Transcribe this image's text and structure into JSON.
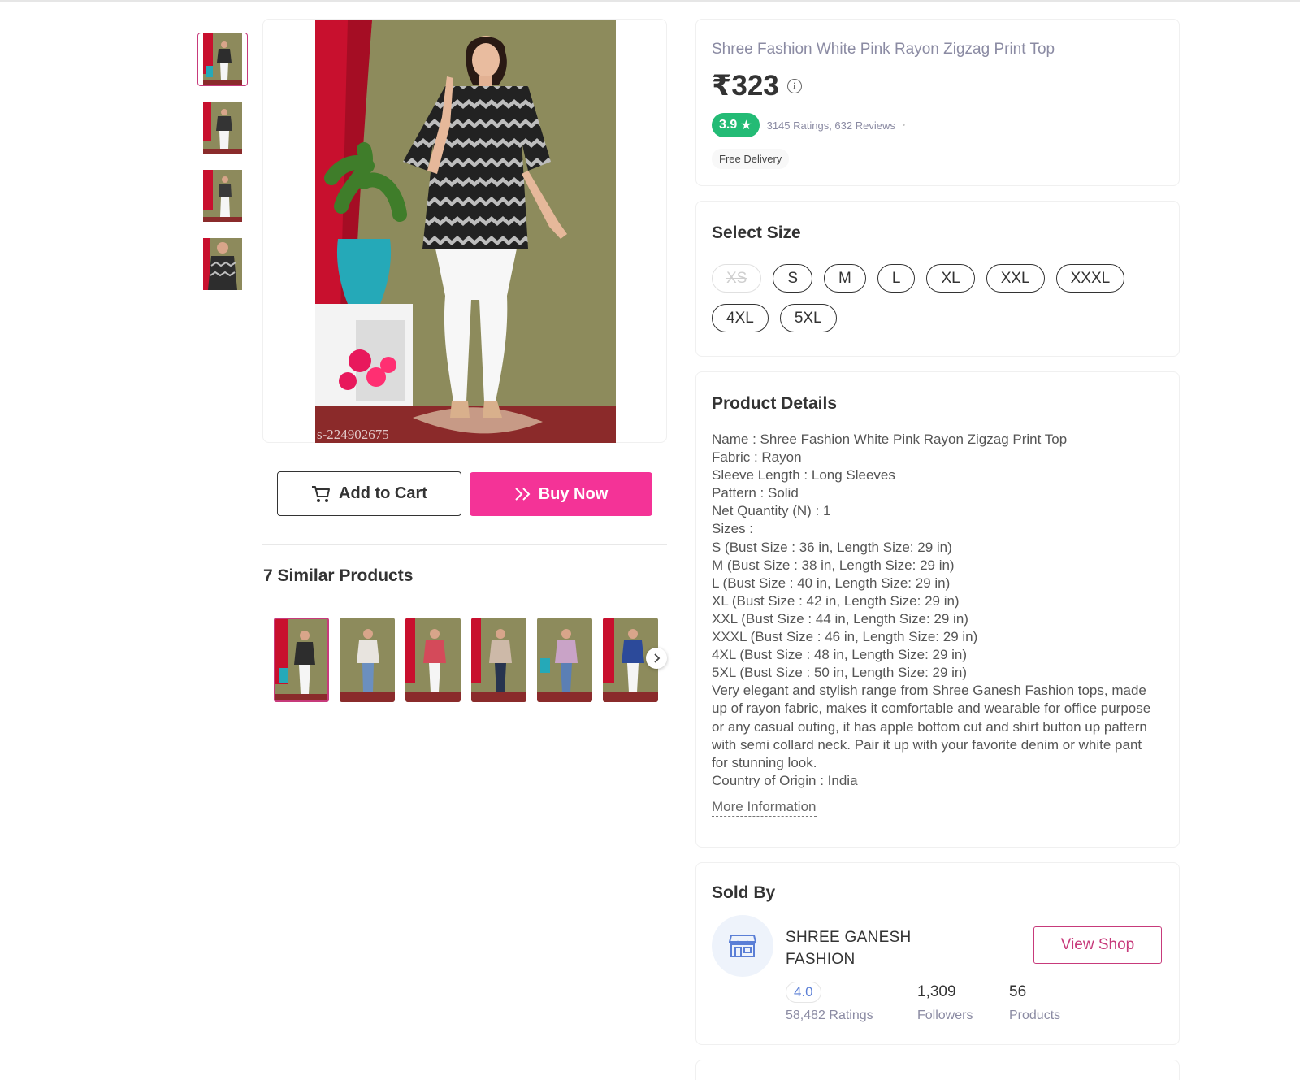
{
  "product": {
    "title": "Shree Fashion White Pink Rayon Zigzag Print Top",
    "price": "₹323",
    "rating": "3.9",
    "ratings_text": "3145 Ratings, 632 Reviews",
    "delivery": "Free Delivery",
    "image_code": "s-224902675"
  },
  "actions": {
    "add_to_cart": "Add to Cart",
    "buy_now": "Buy Now"
  },
  "similar": {
    "title": "7 Similar Products"
  },
  "size": {
    "title": "Select Size",
    "options": [
      "XS",
      "S",
      "M",
      "L",
      "XL",
      "XXL",
      "XXXL",
      "4XL",
      "5XL"
    ],
    "unavailable": [
      "XS"
    ]
  },
  "details": {
    "title": "Product Details",
    "lines": [
      "Name : Shree Fashion White Pink Rayon Zigzag Print Top",
      "Fabric : Rayon",
      "Sleeve Length : Long Sleeves",
      "Pattern : Solid",
      "Net Quantity (N) : 1",
      "Sizes :",
      "S (Bust Size : 36 in, Length Size: 29 in)",
      "M (Bust Size : 38 in, Length Size: 29 in)",
      "L (Bust Size : 40 in, Length Size: 29 in)",
      "XL (Bust Size : 42 in, Length Size: 29 in)",
      "XXL (Bust Size : 44 in, Length Size: 29 in)",
      "XXXL (Bust Size : 46 in, Length Size: 29 in)",
      "4XL (Bust Size : 48 in, Length Size: 29 in)",
      "5XL (Bust Size : 50 in, Length Size: 29 in)"
    ],
    "description": "Very elegant and stylish range from Shree Ganesh Fashion tops, made up of rayon fabric, makes it comfortable and wearable for office purpose or any casual outing, it has apple bottom cut and shirt button up pattern with semi collard neck. Pair it up with your favorite denim or white pant for stunning look.",
    "origin": "Country of Origin : India",
    "more": "More Information"
  },
  "seller": {
    "title": "Sold By",
    "name": "SHREE GANESH FASHION",
    "view_shop": "View Shop",
    "rating": "4.0",
    "ratings_label": "58,482 Ratings",
    "followers": "1,309",
    "followers_label": "Followers",
    "products": "56",
    "products_label": "Products"
  },
  "colors": {
    "accent": "#f43397",
    "brand_text": "#c73a7b",
    "rating_green": "#23bb75"
  }
}
